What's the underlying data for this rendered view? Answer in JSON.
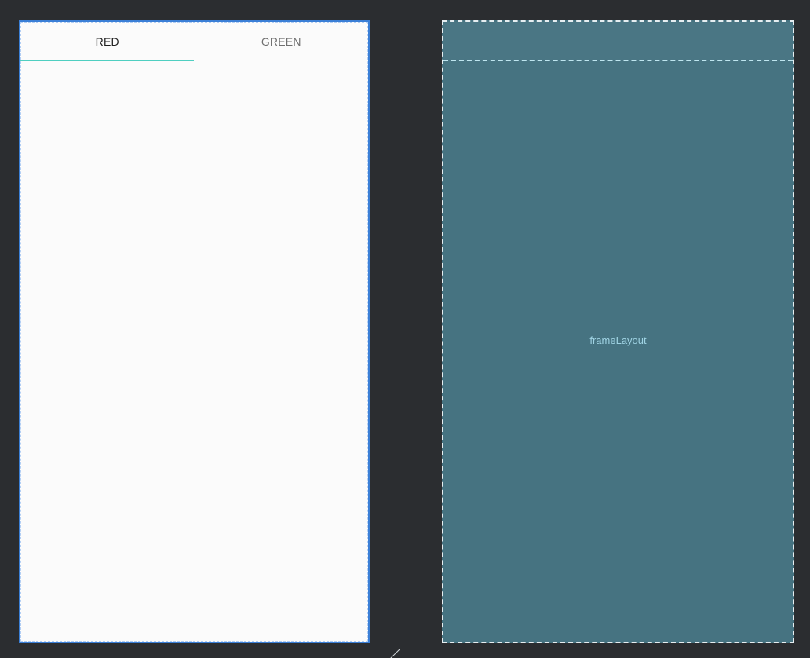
{
  "design": {
    "tabs": [
      {
        "label": "RED",
        "selected": true
      },
      {
        "label": "GREEN",
        "selected": false
      }
    ],
    "indicator_color": "#4fcfc1",
    "background": "#fbfbfb",
    "selection_border_color": "#3b7fd6"
  },
  "blueprint": {
    "frame_label": "frameLayout",
    "background": "#467381",
    "label_color": "#9fd3e3"
  },
  "icons": {
    "resize_handle": "resize-handle-icon"
  }
}
